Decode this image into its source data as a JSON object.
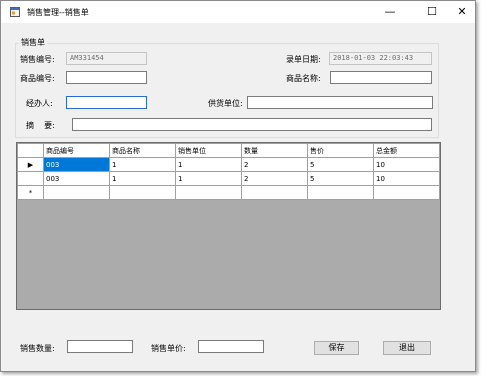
{
  "window": {
    "title": "销售管理--销售单"
  },
  "group": {
    "title": "销售单"
  },
  "form": {
    "sale_no_label": "销售编号:",
    "sale_no_value": "AM331454",
    "date_label": "录单日期:",
    "date_value": "2018-01-03 22:03:43",
    "product_no_label": "商品编号:",
    "product_no_value": "",
    "product_name_label": "商品名称:",
    "product_name_value": "",
    "handler_label": "经办人:",
    "handler_value": "",
    "supplier_label": "供货单位:",
    "supplier_value": "",
    "summary_label": "摘    要:",
    "summary_value": ""
  },
  "grid": {
    "columns": [
      "商品编号",
      "商品名称",
      "销售单位",
      "数量",
      "售价",
      "总金额"
    ],
    "rows": [
      [
        "003",
        "1",
        "1",
        "2",
        "5",
        "10"
      ],
      [
        "003",
        "1",
        "1",
        "2",
        "5",
        "10"
      ]
    ],
    "current_row_marker": "▶",
    "new_row_marker": "*"
  },
  "footer": {
    "qty_label": "销售数量:",
    "qty_value": "",
    "price_label": "销售单价:",
    "price_value": "",
    "save_label": "保存",
    "exit_label": "退出"
  }
}
